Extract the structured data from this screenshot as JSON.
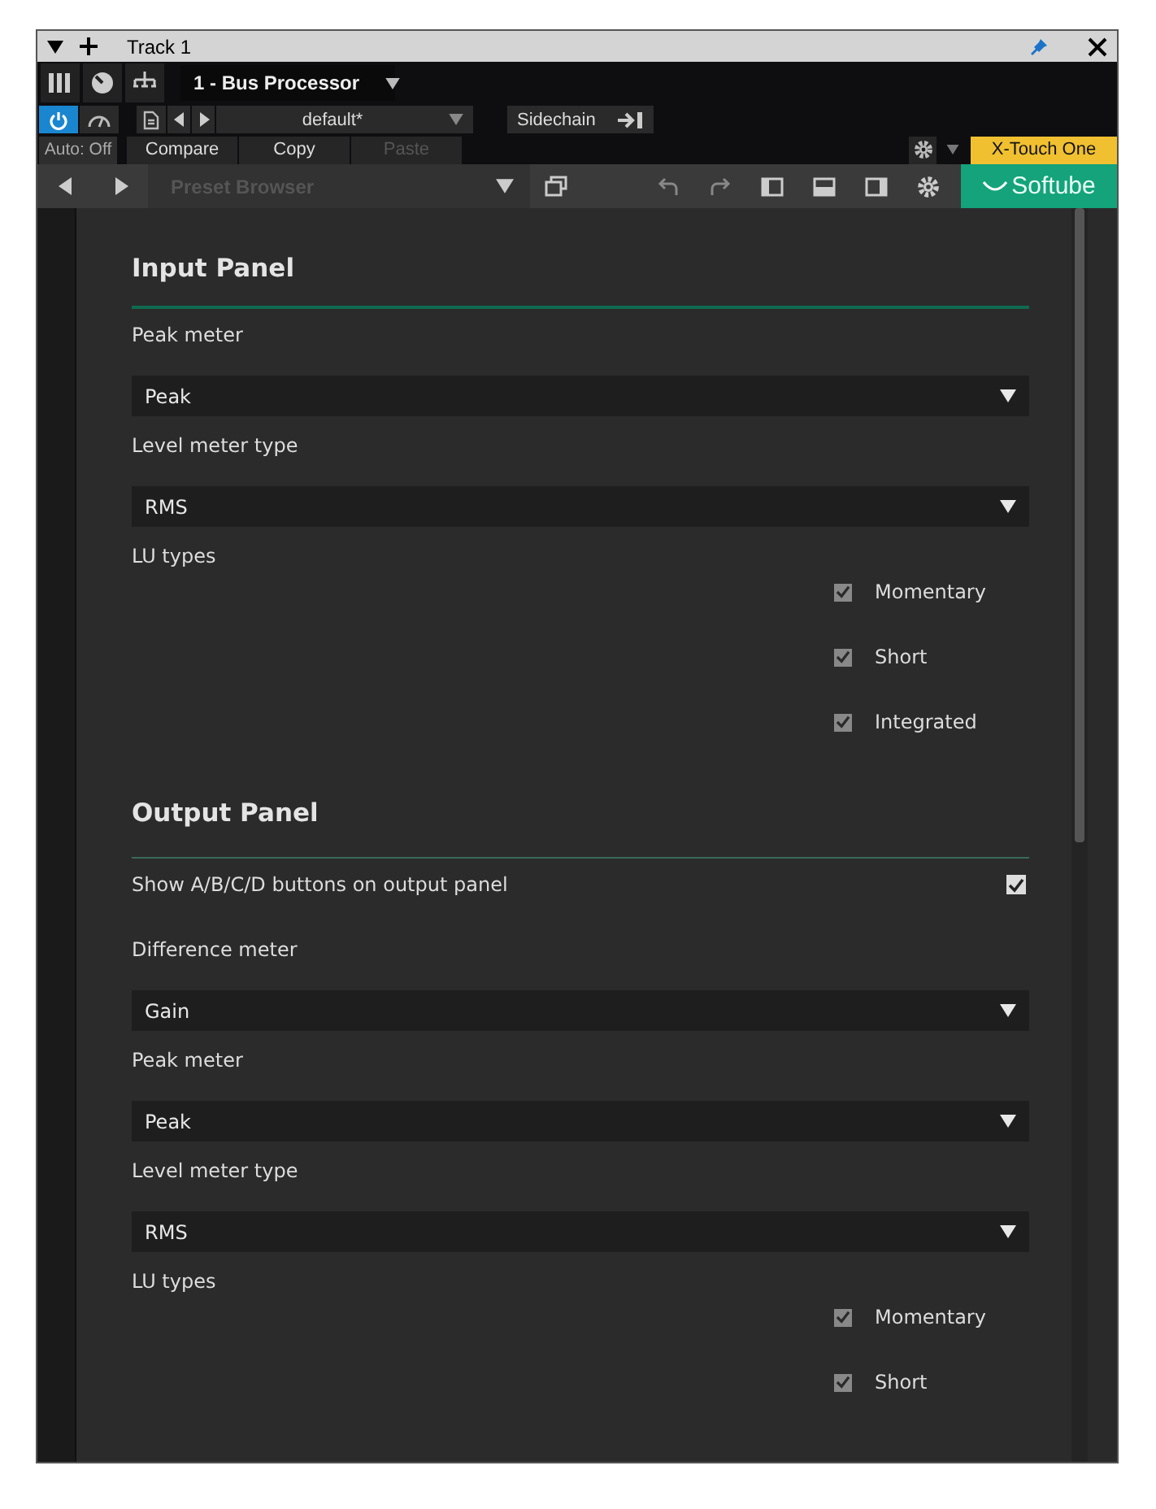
{
  "window": {
    "title": "Track 1"
  },
  "plugin_header": {
    "device": "1 - Bus Processor",
    "power_on": true,
    "preset": "default*",
    "sidechain": "Sidechain",
    "automation": "Auto: Off",
    "buttons": [
      {
        "label": "Compare",
        "disabled": false
      },
      {
        "label": "Copy",
        "disabled": false
      },
      {
        "label": "Paste",
        "disabled": true
      }
    ],
    "controller": "X-Touch One"
  },
  "toolbar": {
    "preset_browser": "Preset Browser",
    "brand": "Softube"
  },
  "sections": [
    {
      "title": "Input Panel",
      "settings": [
        {
          "kind": "dropdown",
          "label": "Peak meter",
          "value": "Peak"
        },
        {
          "kind": "dropdown",
          "label": "Level meter type",
          "value": "RMS"
        },
        {
          "kind": "checklist",
          "label": "LU types",
          "options": [
            {
              "label": "Momentary",
              "checked": true
            },
            {
              "label": "Short",
              "checked": true
            },
            {
              "label": "Integrated",
              "checked": true
            }
          ]
        }
      ]
    },
    {
      "title": "Output Panel",
      "settings": [
        {
          "kind": "checkbox",
          "label": "Show A/B/C/D buttons on output panel",
          "checked": true
        },
        {
          "kind": "dropdown",
          "label": "Difference meter",
          "value": "Gain"
        },
        {
          "kind": "dropdown",
          "label": "Peak meter",
          "value": "Peak"
        },
        {
          "kind": "dropdown",
          "label": "Level meter type",
          "value": "RMS"
        },
        {
          "kind": "checklist",
          "label": "LU types",
          "options": [
            {
              "label": "Momentary",
              "checked": true
            },
            {
              "label": "Short",
              "checked": true
            }
          ]
        }
      ]
    }
  ]
}
